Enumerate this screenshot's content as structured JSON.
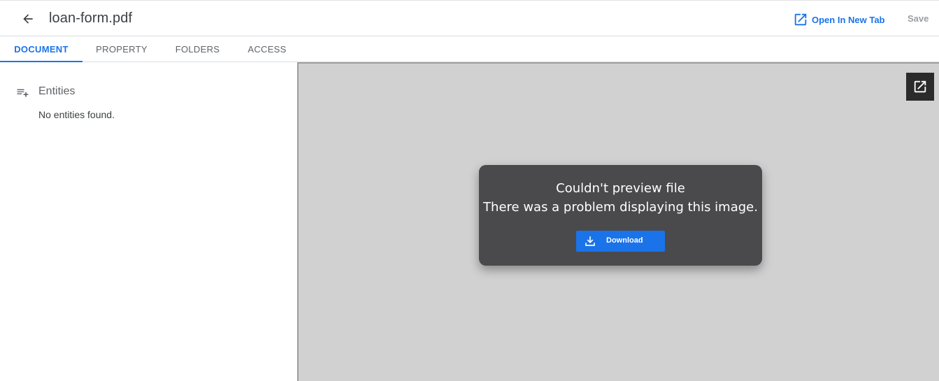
{
  "header": {
    "title": "loan-form.pdf",
    "open_new_tab_label": "Open In New Tab",
    "save_label": "Save"
  },
  "tabs": [
    {
      "label": "DOCUMENT",
      "active": true
    },
    {
      "label": "PROPERTY",
      "active": false
    },
    {
      "label": "FOLDERS",
      "active": false
    },
    {
      "label": "ACCESS",
      "active": false
    }
  ],
  "entities": {
    "title": "Entities",
    "empty_message": "No entities found."
  },
  "preview": {
    "error_title": "Couldn't preview file",
    "error_message": "There was a problem displaying this image.",
    "download_label": "Download"
  },
  "icons": {
    "back": "arrow-back-icon",
    "open_new_tab": "open-in-new-icon",
    "entities": "playlist-add-icon",
    "popout": "open-in-new-icon",
    "download": "download-icon"
  },
  "colors": {
    "accent": "#1a73e8",
    "preview_bg": "#d1d1d1",
    "card_bg": "#4a4a4d"
  }
}
